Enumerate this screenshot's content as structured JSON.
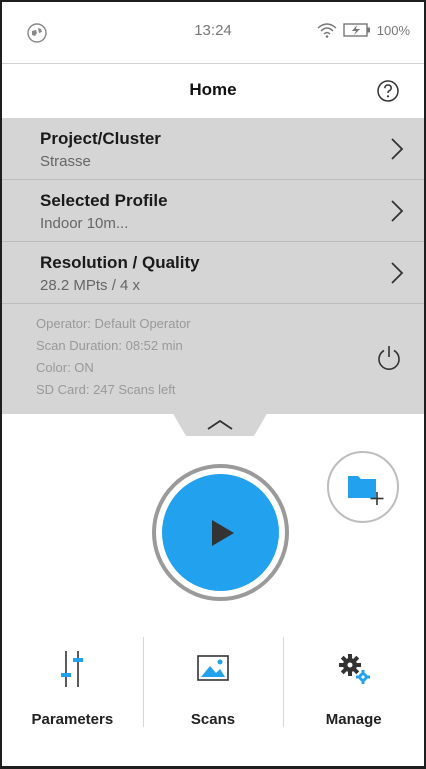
{
  "status_bar": {
    "time": "13:24",
    "battery": "100%",
    "left_icon": "globe-icon",
    "wifi_icon": "wifi-icon",
    "battery_icon": "battery-charging-icon"
  },
  "header": {
    "title": "Home",
    "help_icon": "help-icon"
  },
  "menu": {
    "items": [
      {
        "label": "Project/Cluster",
        "value": "Strasse",
        "icon": "chevron-right-icon"
      },
      {
        "label": "Selected Profile",
        "value": "Indoor 10m...",
        "icon": "chevron-right-icon"
      },
      {
        "label": "Resolution / Quality",
        "value": "28.2 MPts / 4 x",
        "icon": "chevron-right-icon"
      }
    ]
  },
  "info": {
    "operator": "Operator: Default Operator",
    "scan_duration": "Scan Duration: 08:52 min",
    "color": "Color: ON",
    "sd_card": "SD Card: 247 Scans left",
    "power_icon": "power-icon"
  },
  "actions": {
    "add_folder_icon": "folder-add-icon",
    "start_scan_icon": "play-icon",
    "accent": "#22a1ef"
  },
  "bottom_nav": {
    "items": [
      {
        "label": "Parameters",
        "icon": "sliders-icon"
      },
      {
        "label": "Scans",
        "icon": "image-icon"
      },
      {
        "label": "Manage",
        "icon": "gears-icon"
      }
    ]
  }
}
